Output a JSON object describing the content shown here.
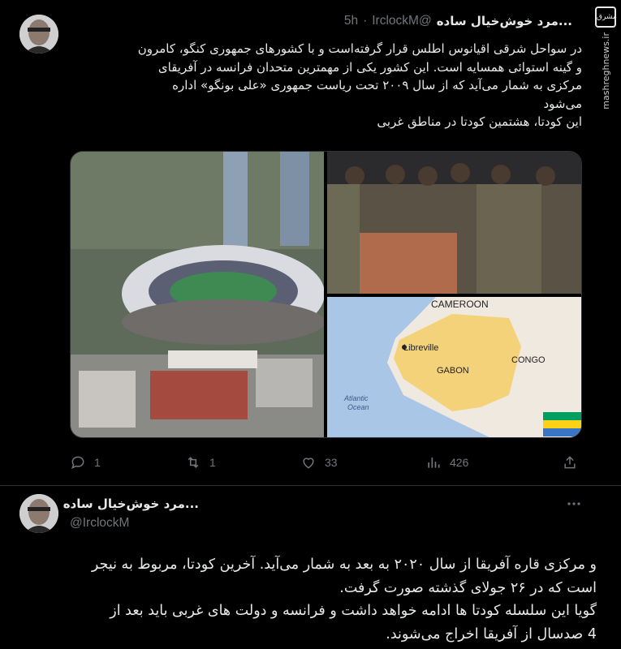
{
  "watermark": {
    "logo": "مشرق",
    "site": "mashreghnews.ir"
  },
  "tweet1": {
    "author_name": "...مرد خوش‌خیال ساده",
    "handle": "@IrclockM",
    "time": "5h",
    "separator": "·",
    "lines": [
      "در سواحل شرقی اقیانوس اطلس قرار گرفته‌است و با کشورهای جمهوری کنگو، کامرون",
      "و گینه استوائی همسایه است. این کشور یکی از مهمترین متحدان فرانسه در آفریقای",
      "مرکزی به شمار می‌آید که از سال ۲۰۰۹ تحت ریاست جمهوری «علی بونگو» اداره",
      "می‌شود",
      "این کودتا، هشتمین کودتا در مناطق غربی"
    ],
    "map_labels": {
      "cameroon": "CAMEROON",
      "libreville": "Libreville",
      "gabon": "GABON",
      "congo": "CONGO",
      "atlantic": "Atlantic",
      "ocean": "Ocean"
    },
    "actions": {
      "replies": "1",
      "retweets": "1",
      "likes": "33",
      "views": "426"
    },
    "icons": [
      "reply-icon",
      "retweet-icon",
      "like-icon",
      "views-icon",
      "share-icon"
    ]
  },
  "tweet2": {
    "author_name": "...مرد خوش‌خیال ساده",
    "handle": "@IrclockM",
    "lines": [
      "و مرکزی قاره آفریقا از سال ۲۰۲۰ به بعد به شمار می‌آید. آخرین کودتا، مربوط به نیجر",
      "است که در ۲۶ جولای گذشته صورت گرفت.",
      "گویا این سلسله کودتا ها ادامه خواهد داشت و فرانسه و دولت های غربی باید بعد از",
      "4 صدسال از آفریقا اخراج می‌شوند."
    ]
  },
  "colors": {
    "background": "#000000",
    "text": "#e7e9ea",
    "secondary": "#71767b",
    "border": "#2f3336",
    "flag_green": "#009e60",
    "flag_yellow": "#fcd116",
    "flag_blue": "#3a75c4"
  }
}
